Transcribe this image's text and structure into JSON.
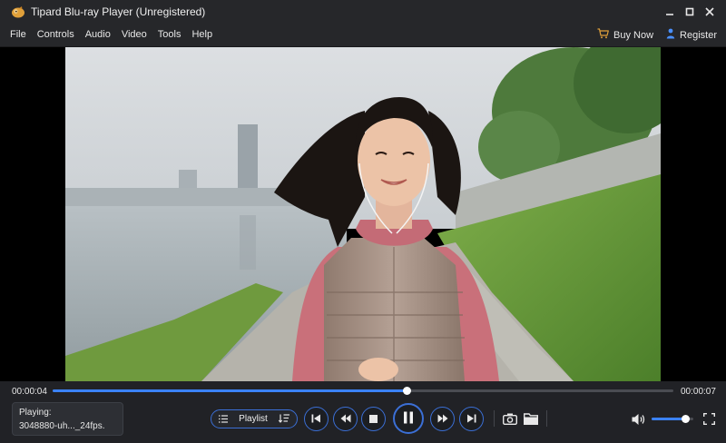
{
  "window": {
    "title": "Tipard Blu-ray Player (Unregistered)"
  },
  "menu": {
    "items": [
      "File",
      "Controls",
      "Audio",
      "Video",
      "Tools",
      "Help"
    ],
    "buy_now": "Buy Now",
    "register": "Register"
  },
  "playback": {
    "current_time": "00:00:04",
    "total_time": "00:00:07",
    "progress": 0.57,
    "now_playing_label": "Playing:",
    "now_playing_file": "3048880-uh..._24fps.",
    "playlist_label": "Playlist",
    "volume": 0.8
  },
  "colors": {
    "accent": "#3b82f6",
    "button_border": "#3b6fd6",
    "background": "#212226"
  },
  "icons": {
    "app": "tipard-logo-icon",
    "minimize": "minimize-icon",
    "maximize": "maximize-icon",
    "close": "close-icon",
    "cart": "cart-icon",
    "register": "person-icon",
    "playlist_list": "list-icon",
    "playlist_order": "sort-icon",
    "previous": "skip-previous-icon",
    "rewind": "rewind-icon",
    "stop": "stop-icon",
    "pause": "pause-icon",
    "forward": "fast-forward-icon",
    "next": "skip-next-icon",
    "snapshot": "camera-icon",
    "open": "folder-icon",
    "volume": "volume-icon",
    "fullscreen": "fullscreen-icon"
  }
}
